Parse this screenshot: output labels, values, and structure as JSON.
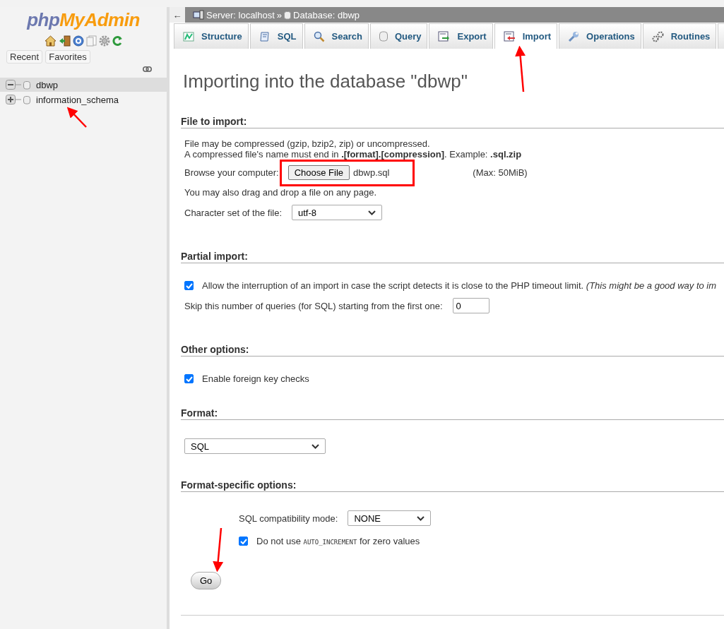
{
  "sidebar": {
    "logo": {
      "first": "php",
      "second": "MyAdmin"
    },
    "buttons": [
      "Recent",
      "Favorites"
    ],
    "tree": [
      {
        "label": "dbwp",
        "expanded": true,
        "selected": true
      },
      {
        "label": "information_schema",
        "expanded": false,
        "selected": false
      }
    ]
  },
  "breadcrumb": {
    "back": "←",
    "server": "Server: localhost",
    "separator": "»",
    "database": "Database: dbwp"
  },
  "tabs": [
    {
      "label": "Structure",
      "selected": false
    },
    {
      "label": "SQL",
      "selected": false
    },
    {
      "label": "Search",
      "selected": false
    },
    {
      "label": "Query",
      "selected": false
    },
    {
      "label": "Export",
      "selected": false
    },
    {
      "label": "Import",
      "selected": true
    },
    {
      "label": "Operations",
      "selected": false
    },
    {
      "label": "Routines",
      "selected": false
    },
    {
      "selected": false
    }
  ],
  "heading": "Importing into the database \"dbwp\"",
  "file_to_import": {
    "title": "File to import:",
    "note": "File may be compressed (gzip, bzip2, zip) or uncompressed.",
    "note2": "A compressed file's name must end in **.[format].[compression]**. Example: **.sql.zip**",
    "browse_label": "Browse your computer:",
    "choose_button": "Choose File",
    "file_name": "dbwp.sql",
    "max": "(Max: 50MiB)",
    "drag_note": "You may also drag and drop a file on any page.",
    "charset_label": "Character set of the file:",
    "charset": "utf-8"
  },
  "partial_import": {
    "title": "Partial import:",
    "allow": {
      "label": "Allow the interruption of an import in case the script detects it is close to the PHP timeout limit. *(This might be a good way to im*",
      "checked": true
    },
    "skip_label": "Skip this number of queries (for SQL) starting from the first one:",
    "skip_value": "0"
  },
  "other_options": {
    "title": "Other options:",
    "foreign_keys": {
      "label": "Enable foreign key checks",
      "checked": true
    }
  },
  "format": {
    "title": "Format:",
    "value": "SQL"
  },
  "format_options": {
    "title": "Format-specific options:",
    "compat_label": "SQL compatibility mode:",
    "compat_value": "NONE",
    "auto_increment": {
      "before": "Do not use",
      "code": "AUTO_INCREMENT",
      "after": "for zero values",
      "checked": true
    }
  },
  "go_button": "Go"
}
